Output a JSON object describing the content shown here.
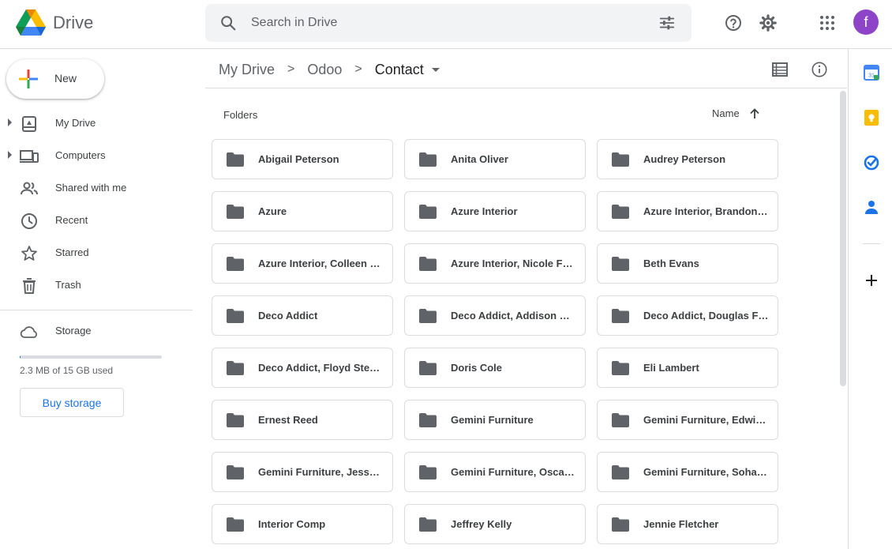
{
  "header": {
    "brand": "Drive",
    "search_placeholder": "Search in Drive",
    "avatar_initial": "f"
  },
  "sidebar": {
    "new_label": "New",
    "items": [
      {
        "label": "My Drive",
        "icon": "my-drive-icon",
        "expandable": true
      },
      {
        "label": "Computers",
        "icon": "computers-icon",
        "expandable": true
      },
      {
        "label": "Shared with me",
        "icon": "shared-icon",
        "expandable": false
      },
      {
        "label": "Recent",
        "icon": "clock-icon",
        "expandable": false
      },
      {
        "label": "Starred",
        "icon": "star-icon",
        "expandable": false
      },
      {
        "label": "Trash",
        "icon": "trash-icon",
        "expandable": false
      }
    ],
    "storage_label": "Storage",
    "storage_used_text": "2.3 MB of 15 GB used",
    "storage_used_fraction": 0.0002,
    "buy_storage_label": "Buy storage"
  },
  "breadcrumb": {
    "items": [
      "My Drive",
      "Odoo"
    ],
    "current": "Contact"
  },
  "content": {
    "section_label": "Folders",
    "sort_label": "Name",
    "folders": [
      "Abigail Peterson",
      "Anita Oliver",
      "Audrey Peterson",
      "Azure",
      "Azure Interior",
      "Azure Interior, Brandon Freeman",
      "Azure Interior, Colleen Diaz",
      "Azure Interior, Nicole Ford",
      "Beth Evans",
      "Deco Addict",
      "Deco Addict, Addison Olson",
      "Deco Addict, Douglas Fletcher",
      "Deco Addict, Floyd Steward",
      "Doris Cole",
      "Eli Lambert",
      "Ernest Reed",
      "Gemini Furniture",
      "Gemini Furniture, Edwin Hansen",
      "Gemini Furniture, Jesse Brown",
      "Gemini Furniture, Oscar Morgan",
      "Gemini Furniture, Soham Palmer",
      "Interior Comp",
      "Jeffrey Kelly",
      "Jennie Fletcher"
    ]
  },
  "colors": {
    "accent": "#1a73e8",
    "avatar": "#8e44c9",
    "folder_icon": "#5f6368"
  }
}
